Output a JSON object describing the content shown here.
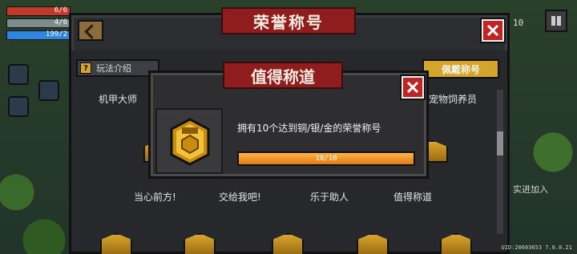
{
  "hud": {
    "hp": "6/6",
    "shield": "4/6",
    "energy": "199/2",
    "gold": "10",
    "side_text": "实进加入",
    "uid": "UID:20603653 7.6.0.21"
  },
  "panel": {
    "title": "荣誉称号",
    "guide_label": "玩法介绍",
    "guide_icon": "?",
    "wear_label": "佩戴称号",
    "grid": [
      {
        "label": "机甲大师"
      },
      {
        "label": "宠物饲养员"
      },
      {
        "label": "当心前方!"
      },
      {
        "label": "交给我吧!"
      },
      {
        "label": "乐于助人"
      },
      {
        "label": "值得称道"
      }
    ]
  },
  "popup": {
    "title": "值得称道",
    "description": "拥有10个达到铜/银/金的荣誉称号",
    "progress_text": "10/10",
    "progress_value": 1.0
  },
  "colors": {
    "ribbon": "#8f1d1d",
    "gold": "#d3a52d",
    "close_red": "#c02525",
    "progress_orange": "#f59a2a"
  },
  "icons": {
    "back": "back-arrow-icon",
    "close": "close-x-icon",
    "medal": "medal-badge-icon",
    "question": "question-icon"
  }
}
